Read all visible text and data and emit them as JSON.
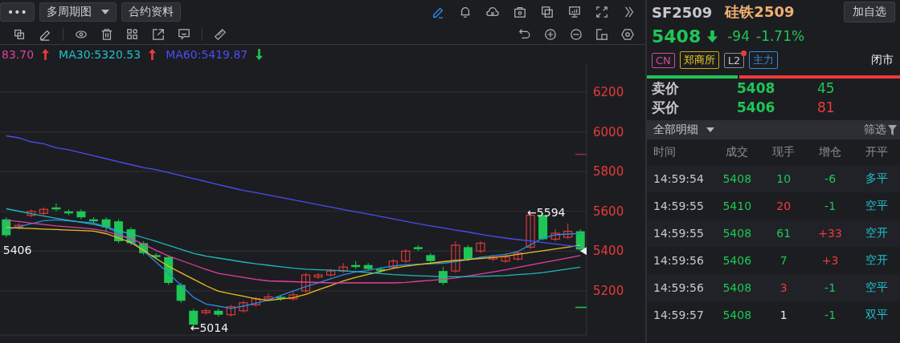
{
  "toolbar": {
    "more_button": "•••",
    "period_button": "多周期图",
    "info_button": "合约资料",
    "draw_tool": {
      "selected": true
    }
  },
  "legend": [
    {
      "text": "83.70",
      "color": "#e0409a",
      "rising": true
    },
    {
      "text": "MA30:5320.53",
      "color": "#1fc0c8",
      "rising": true
    },
    {
      "text": "MA60:5419.87",
      "color": "#4a4ef0",
      "rising": false
    }
  ],
  "chart": {
    "chart_data": {
      "type": "candlestick",
      "ylim": [
        4978,
        6341
      ],
      "yticks": [
        5200,
        5400,
        5600,
        5800,
        6000,
        6200
      ],
      "grid": true,
      "ohlc": [
        [
          5560,
          5570,
          5470,
          5480
        ],
        [
          5520,
          5540,
          5510,
          5530
        ],
        [
          5580,
          5610,
          5570,
          5600
        ],
        [
          5590,
          5620,
          5580,
          5610
        ],
        [
          5620,
          5640,
          5600,
          5610
        ],
        [
          5600,
          5610,
          5580,
          5590
        ],
        [
          5600,
          5610,
          5560,
          5570
        ],
        [
          5560,
          5570,
          5540,
          5550
        ],
        [
          5560,
          5570,
          5500,
          5520
        ],
        [
          5550,
          5560,
          5440,
          5450
        ],
        [
          5510,
          5520,
          5430,
          5440
        ],
        [
          5440,
          5450,
          5380,
          5390
        ],
        [
          5380,
          5390,
          5360,
          5370
        ],
        [
          5370,
          5380,
          5230,
          5240
        ],
        [
          5230,
          5240,
          5140,
          5150
        ],
        [
          5100,
          5110,
          5014,
          5030
        ],
        [
          5090,
          5110,
          5080,
          5100
        ],
        [
          5100,
          5110,
          5070,
          5080
        ],
        [
          5080,
          5130,
          5070,
          5120
        ],
        [
          5100,
          5150,
          5090,
          5140
        ],
        [
          5130,
          5170,
          5120,
          5160
        ],
        [
          5160,
          5190,
          5150,
          5170
        ],
        [
          5170,
          5180,
          5150,
          5160
        ],
        [
          5160,
          5200,
          5150,
          5180
        ],
        [
          5200,
          5290,
          5190,
          5280
        ],
        [
          5270,
          5290,
          5260,
          5280
        ],
        [
          5280,
          5310,
          5270,
          5300
        ],
        [
          5300,
          5340,
          5290,
          5320
        ],
        [
          5330,
          5350,
          5310,
          5320
        ],
        [
          5330,
          5340,
          5300,
          5310
        ],
        [
          5310,
          5320,
          5290,
          5300
        ],
        [
          5320,
          5360,
          5310,
          5350
        ],
        [
          5350,
          5410,
          5340,
          5400
        ],
        [
          5420,
          5430,
          5400,
          5410
        ],
        [
          5380,
          5390,
          5340,
          5350
        ],
        [
          5300,
          5320,
          5230,
          5240
        ],
        [
          5300,
          5450,
          5290,
          5430
        ],
        [
          5420,
          5430,
          5350,
          5360
        ],
        [
          5400,
          5450,
          5390,
          5440
        ],
        [
          5360,
          5380,
          5350,
          5370
        ],
        [
          5350,
          5390,
          5340,
          5370
        ],
        [
          5360,
          5400,
          5350,
          5390
        ],
        [
          5420,
          5594,
          5410,
          5580
        ],
        [
          5580,
          5590,
          5455,
          5460
        ],
        [
          5460,
          5510,
          5450,
          5490
        ],
        [
          5470,
          5540,
          5460,
          5500
        ],
        [
          5500,
          5510,
          5400,
          5408
        ]
      ],
      "series": [
        {
          "type": "line",
          "color": "#2a8ae0",
          "values": [
            5508,
            5523,
            5538,
            5553,
            5557,
            5552,
            5547,
            5542,
            5522,
            5488,
            5455,
            5401,
            5345,
            5288,
            5228,
            5168,
            5134,
            5123,
            5112,
            5123,
            5138,
            5153,
            5177,
            5199,
            5221,
            5241,
            5261,
            5281,
            5295,
            5303,
            5315,
            5325,
            5331,
            5334,
            5336,
            5339,
            5346,
            5357,
            5369,
            5377,
            5384,
            5398,
            5432,
            5466,
            5482,
            5486,
            5489
          ]
        },
        {
          "type": "line",
          "color": "#e8c020",
          "values": [
            5519,
            5516,
            5514,
            5511,
            5509,
            5506,
            5504,
            5501,
            5488,
            5466,
            5443,
            5404,
            5363,
            5324,
            5291,
            5259,
            5226,
            5198,
            5185,
            5173,
            5160,
            5152,
            5159,
            5166,
            5182,
            5205,
            5227,
            5250,
            5268,
            5283,
            5298,
            5313,
            5324,
            5332,
            5339,
            5347,
            5353,
            5358,
            5363,
            5368,
            5375,
            5384,
            5393,
            5402,
            5411,
            5420,
            5429
          ]
        },
        {
          "type": "line",
          "color": "#e040a0",
          "values": [
            5556,
            5549,
            5541,
            5534,
            5527,
            5522,
            5517,
            5511,
            5500,
            5481,
            5463,
            5434,
            5404,
            5376,
            5353,
            5331,
            5308,
            5288,
            5278,
            5268,
            5258,
            5250,
            5248,
            5246,
            5244,
            5242,
            5240,
            5240,
            5240,
            5240,
            5240,
            5240,
            5243,
            5248,
            5253,
            5258,
            5265,
            5275,
            5285,
            5295,
            5306,
            5318,
            5330,
            5342,
            5354,
            5366,
            5378
          ]
        },
        {
          "type": "line",
          "color": "#1fb8c0",
          "values": [
            5613,
            5601,
            5588,
            5576,
            5565,
            5555,
            5545,
            5535,
            5521,
            5503,
            5486,
            5468,
            5449,
            5429,
            5409,
            5389,
            5375,
            5365,
            5355,
            5345,
            5336,
            5329,
            5321,
            5314,
            5309,
            5306,
            5304,
            5301,
            5297,
            5292,
            5287,
            5282,
            5279,
            5276,
            5274,
            5271,
            5271,
            5272,
            5273,
            5275,
            5277,
            5282,
            5286,
            5292,
            5301,
            5310,
            5319
          ]
        },
        {
          "type": "line",
          "color": "#4a4ef0",
          "values": [
            5980,
            5970,
            5950,
            5940,
            5920,
            5910,
            5895,
            5880,
            5865,
            5850,
            5835,
            5820,
            5810,
            5795,
            5780,
            5765,
            5750,
            5735,
            5720,
            5705,
            5694,
            5682,
            5670,
            5658,
            5646,
            5634,
            5622,
            5610,
            5598,
            5586,
            5574,
            5562,
            5550,
            5538,
            5527,
            5517,
            5506,
            5496,
            5485,
            5475,
            5466,
            5458,
            5451,
            5443,
            5436,
            5428,
            5421
          ]
        }
      ],
      "annotations": [
        "←5594",
        "←5014",
        "5406"
      ]
    }
  },
  "quote": {
    "code": "SF2509",
    "name": "硅铁2509",
    "watch_button": "加自选",
    "price": "5408",
    "falling": true,
    "change": "-94",
    "change_pct": "-1.71%",
    "tags": [
      {
        "text": "CN",
        "color": "#d04a9a",
        "dot": false
      },
      {
        "text": "郑商所",
        "color": "#c8a81a",
        "dot": false
      },
      {
        "text": "L2",
        "color": "#8a8c90",
        "dot": true
      },
      {
        "text": "主力",
        "color": "#3a8ad0",
        "dot": false
      }
    ],
    "status": "闭市",
    "ratio": {
      "level": 0.36
    },
    "book": [
      {
        "label": "卖价",
        "price": "5408",
        "volume": "45",
        "color": "#1ec655"
      },
      {
        "label": "买价",
        "price": "5406",
        "volume": "81",
        "color": "#f03a3a"
      }
    ]
  },
  "details": {
    "title": "全部明细",
    "filter": "筛选",
    "columns": [
      "时间",
      "成交",
      "现手",
      "增仓",
      "开平"
    ],
    "rows": [
      {
        "time": "14:59:54",
        "price": "5408",
        "volume": {
          "text": "10",
          "color": "#1ec655"
        },
        "oi": {
          "text": "-6",
          "color": "#1ec655"
        },
        "type": "多平"
      },
      {
        "time": "14:59:55",
        "price": "5410",
        "volume": {
          "text": "20",
          "color": "#f03a3a"
        },
        "oi": {
          "text": "-1",
          "color": "#1ec655"
        },
        "type": "空平"
      },
      {
        "time": "14:59:55",
        "price": "5408",
        "volume": {
          "text": "61",
          "color": "#1ec655"
        },
        "oi": {
          "text": "+33",
          "color": "#f03a3a"
        },
        "type": "空开"
      },
      {
        "time": "14:59:56",
        "price": "5406",
        "volume": {
          "text": "7",
          "color": "#1ec655"
        },
        "oi": {
          "text": "+3",
          "color": "#f03a3a"
        },
        "type": "空开"
      },
      {
        "time": "14:59:56",
        "price": "5408",
        "volume": {
          "text": "3",
          "color": "#f03a3a"
        },
        "oi": {
          "text": "-1",
          "color": "#1ec655"
        },
        "type": "空平"
      },
      {
        "time": "14:59:57",
        "price": "5408",
        "volume": {
          "text": "1",
          "color": "#e8e8e8"
        },
        "oi": {
          "text": "-1",
          "color": "#1ec655"
        },
        "type": "双平"
      }
    ]
  }
}
